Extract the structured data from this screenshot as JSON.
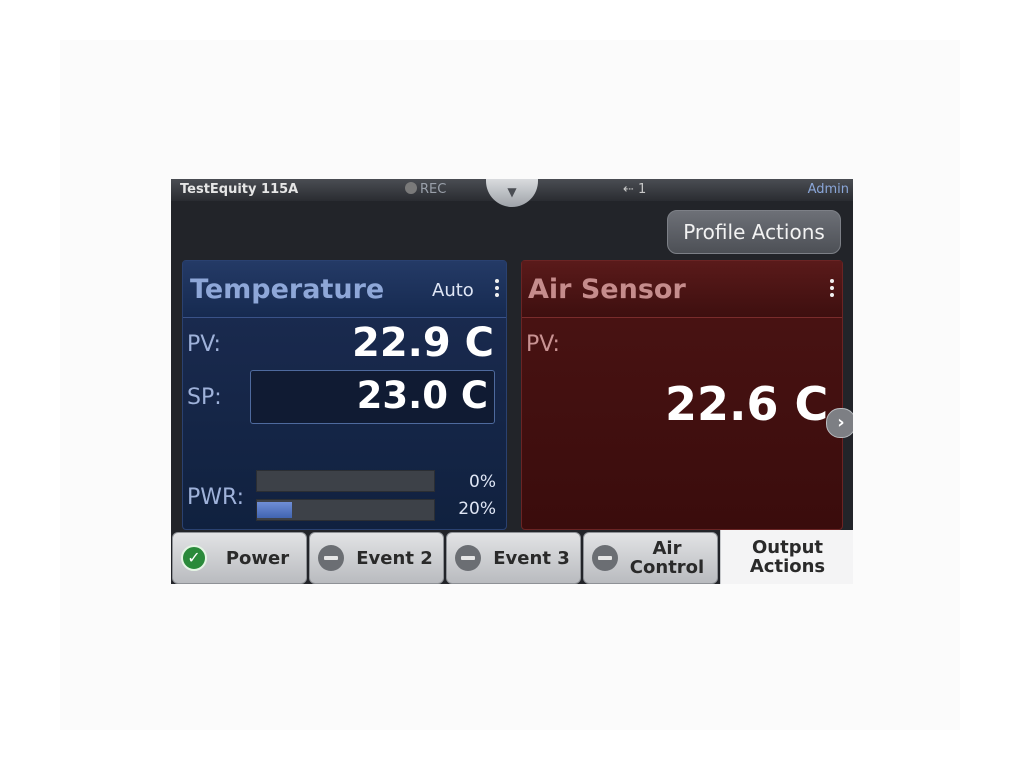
{
  "status_bar": {
    "device_name": "TestEquity 115A",
    "rec_label": "REC",
    "usb_label": "⇠ 1",
    "user": "Admin"
  },
  "profile_actions_label": "Profile Actions",
  "temperature": {
    "title": "Temperature",
    "mode": "Auto",
    "pv_label": "PV:",
    "pv_value": "22.9 C",
    "sp_label": "SP:",
    "sp_value": "23.0 C",
    "pwr_label": "PWR:",
    "power_bars": [
      {
        "percent_label": "0%",
        "fraction": 0.0
      },
      {
        "percent_label": "20%",
        "fraction": 0.2
      }
    ]
  },
  "air_sensor": {
    "title": "Air Sensor",
    "pv_label": "PV:",
    "pv_value": "22.6 C"
  },
  "buttons": {
    "power": {
      "label": "Power",
      "state": "on"
    },
    "event2": {
      "label": "Event 2",
      "state": "off"
    },
    "event3": {
      "label": "Event 3",
      "state": "off"
    },
    "air_control": {
      "label": "Air Control",
      "state": "off"
    },
    "output_actions": {
      "label": "Output Actions"
    }
  },
  "colors": {
    "temperature_panel": "#1c2c52",
    "air_sensor_panel": "#4c1414",
    "power_on_indicator": "#2a8a3a"
  },
  "icons": {
    "rec": "record-icon",
    "usb": "usb-icon",
    "pulldown": "filter-pulldown-icon",
    "next": "chevron-right-icon"
  }
}
